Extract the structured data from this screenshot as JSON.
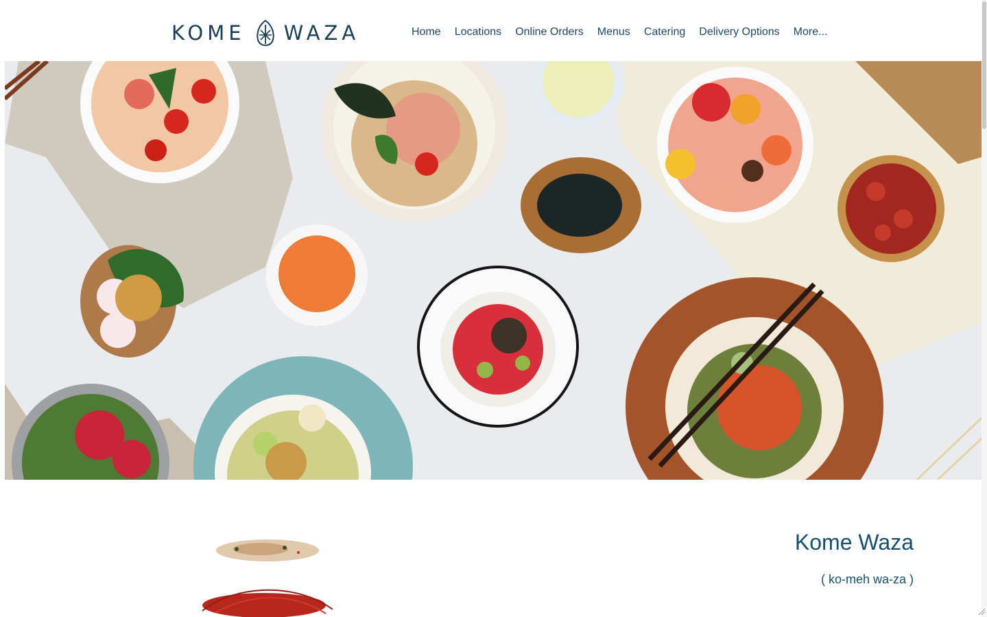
{
  "header": {
    "logo_left": "KOME",
    "logo_right": "WAZA"
  },
  "nav": {
    "items": [
      "Home",
      "Locations",
      "Online Orders",
      "Menus",
      "Catering",
      "Delivery Options",
      "More..."
    ]
  },
  "intro": {
    "title": "Kome Waza",
    "pronunciation": "( ko-meh wa-za )"
  },
  "colors": {
    "brand": "#173f57",
    "heading": "#15506d",
    "nav_text": "#1f4a63"
  }
}
